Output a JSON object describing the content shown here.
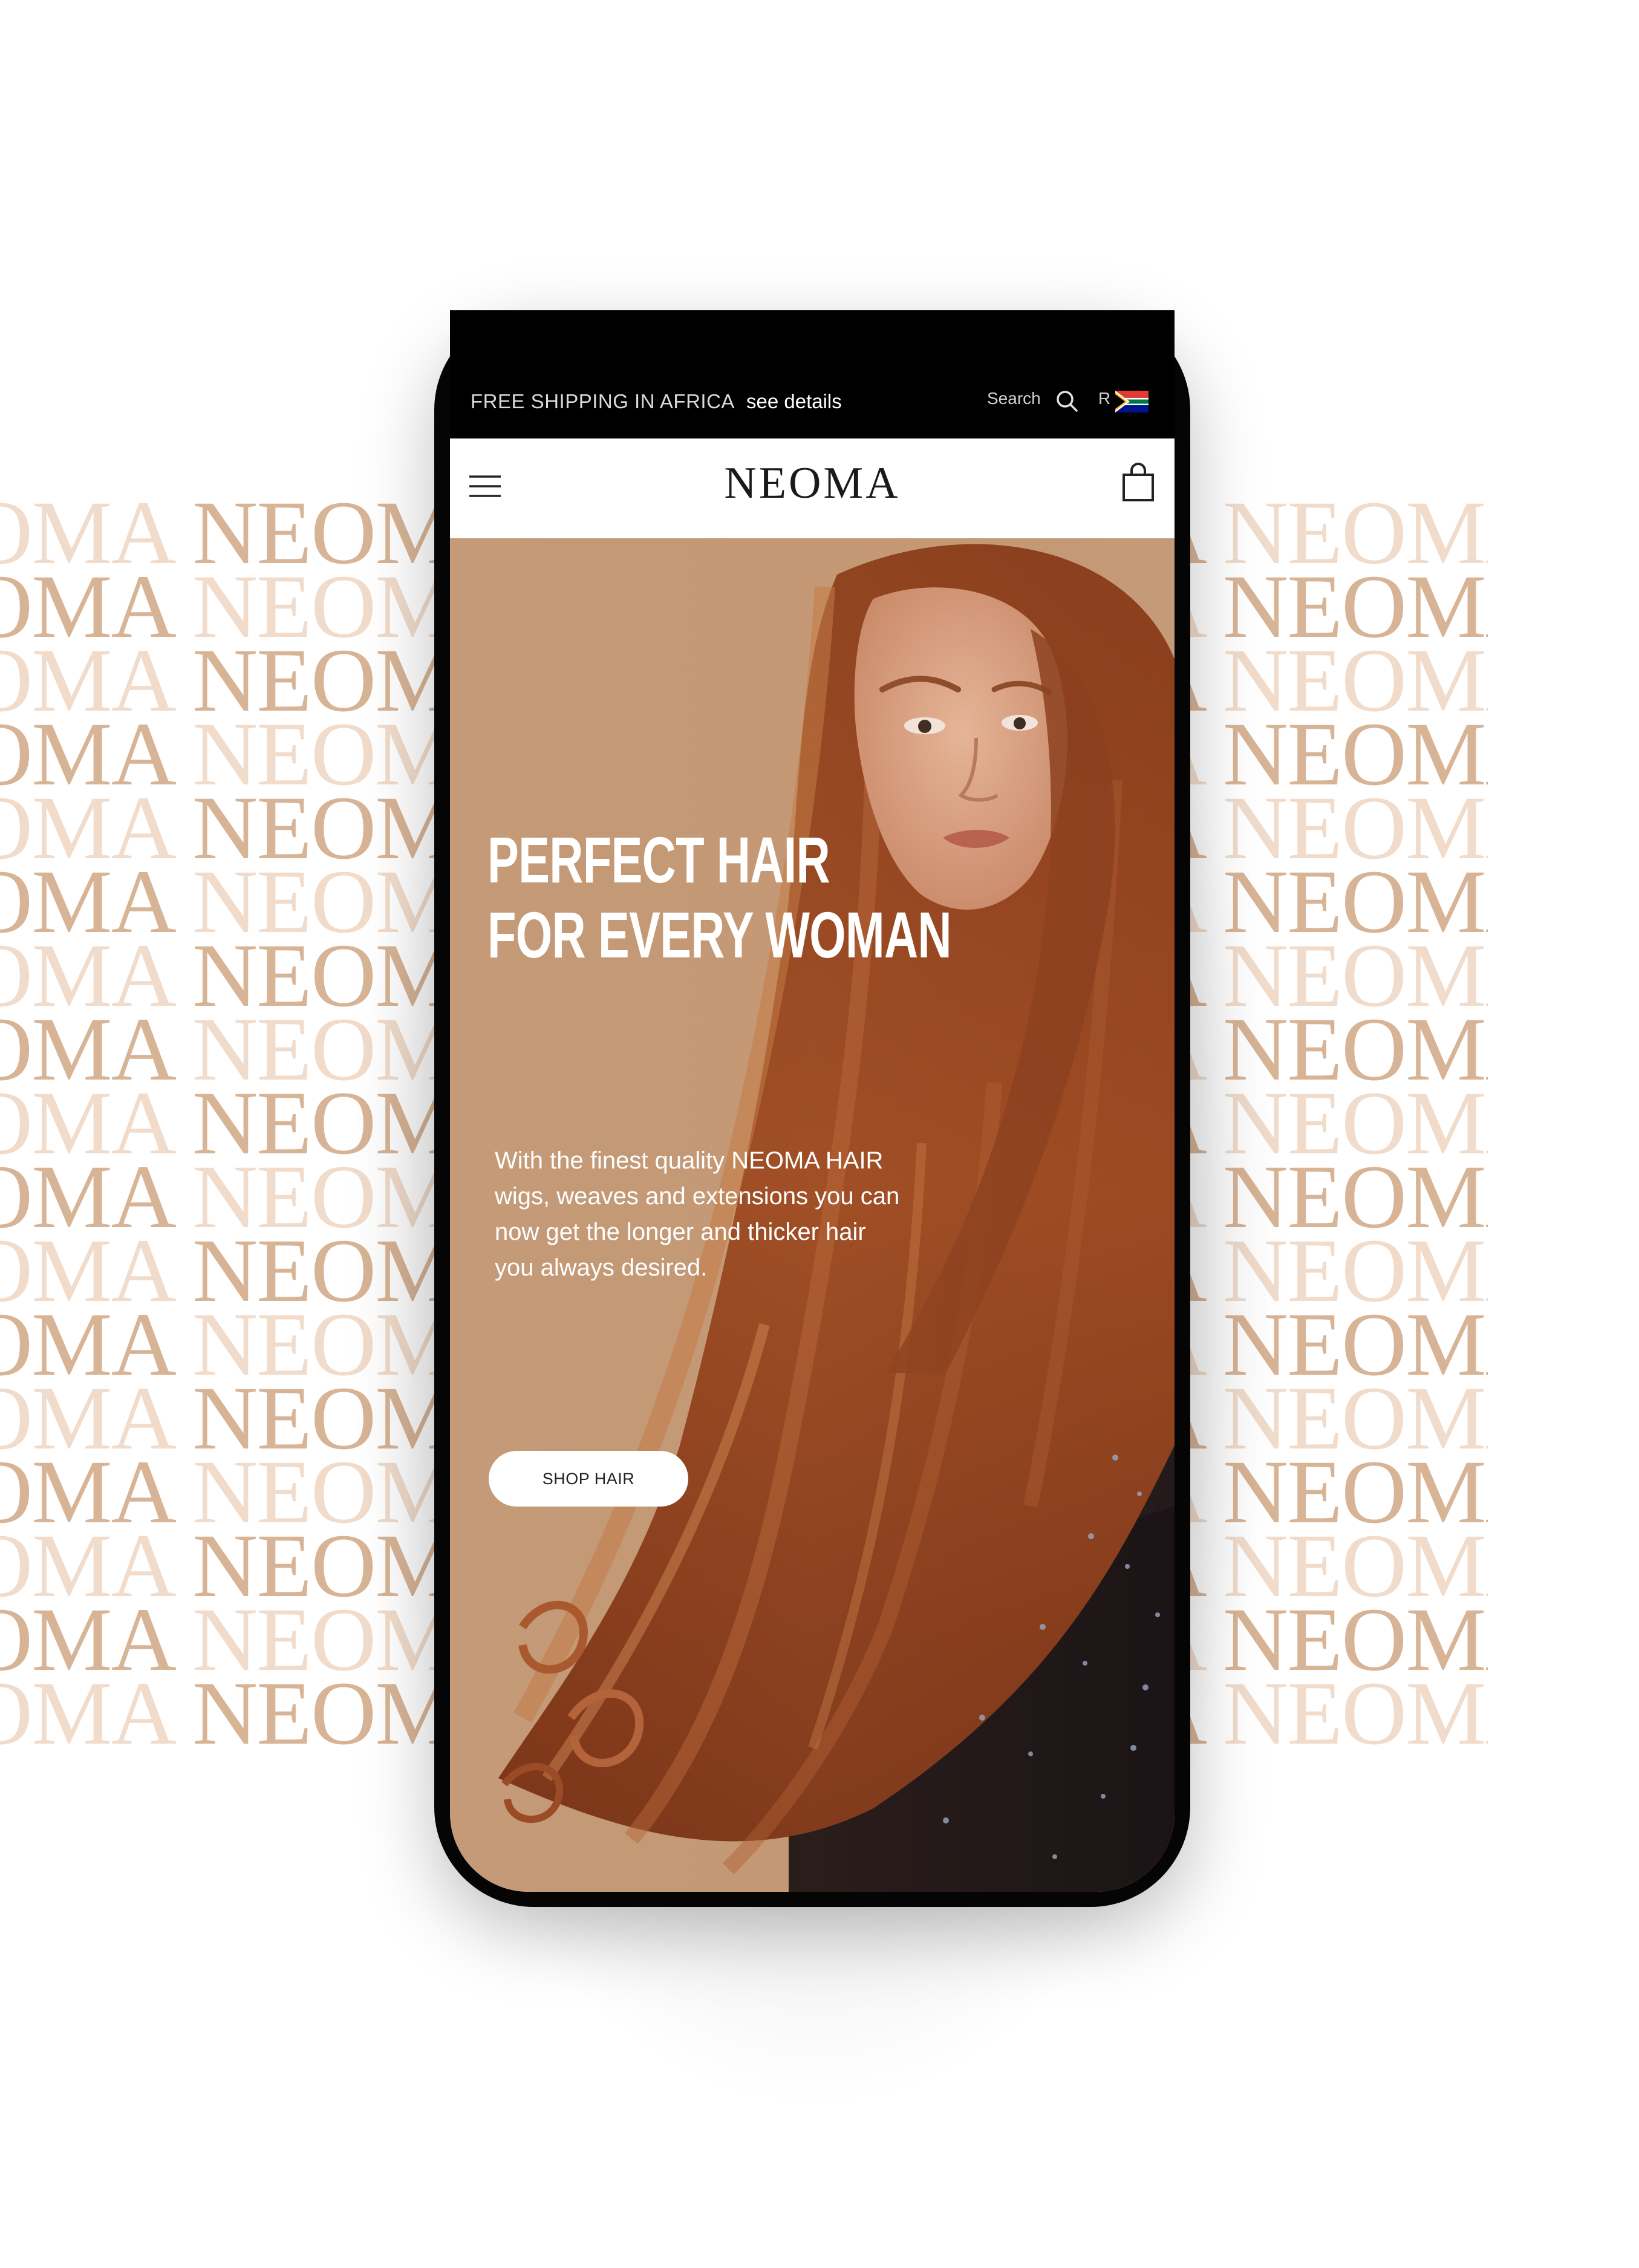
{
  "background": {
    "pattern_word": "NEOMA",
    "colors": {
      "dark": "#d8b496",
      "light": "#f1dccb"
    }
  },
  "topbar": {
    "shipping_text": "FREE SHIPPING IN AFRICA",
    "details_link": "see details",
    "search_label": "Search",
    "search_icon": "search-icon",
    "currency": "R",
    "flag_icon": "south-africa-flag-icon"
  },
  "header": {
    "menu_icon": "hamburger-menu-icon",
    "brand": "NEOMA",
    "cart_icon": "shopping-bag-icon"
  },
  "hero": {
    "title_line1": "PERFECT HAIR",
    "title_line2": "FOR EVERY WOMAN",
    "description": "With the finest quality NEOMA HAIR wigs, weaves and extensions you can now get the longer and thicker hair you always desired.",
    "cta_label": "SHOP HAIR"
  }
}
